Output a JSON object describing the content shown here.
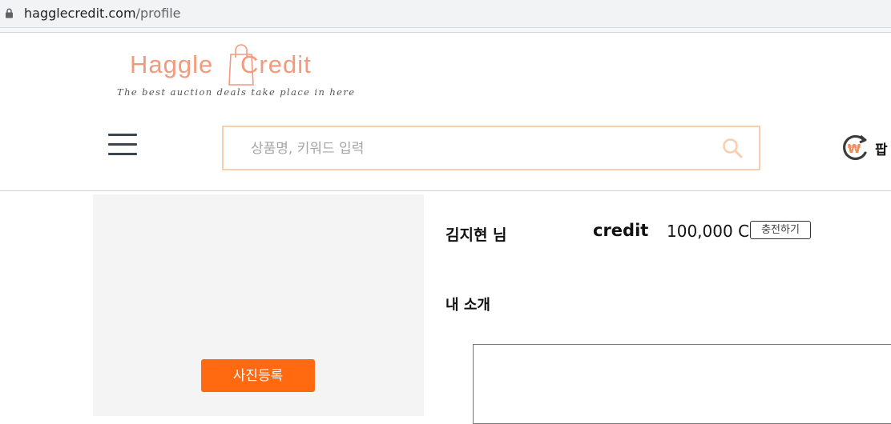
{
  "browser": {
    "url_domain": "hagglecredit.com",
    "url_path": "/profile",
    "lock_icon": "lock-icon"
  },
  "header": {
    "logo": {
      "word1": "Haggle",
      "word2": "Credit",
      "tagline": "The best auction deals take place in here",
      "color": "#f39a7c"
    },
    "menu_icon": "hamburger-menu-icon",
    "search": {
      "placeholder": "상품명, 키워드 입력",
      "value": "",
      "icon": "search-icon",
      "border_color": "#f8cfae"
    },
    "pay": {
      "icon": "won-refresh-icon",
      "label": "팝"
    }
  },
  "profile": {
    "photo_button_label": "사진등록",
    "photo_button_color": "#ff6a10",
    "user_name": "김지현 님",
    "credit_label": "credit",
    "credit_amount": "100,000 C",
    "charge_button_label": "충전하기",
    "intro_label": "내 소개",
    "intro_value": ""
  }
}
